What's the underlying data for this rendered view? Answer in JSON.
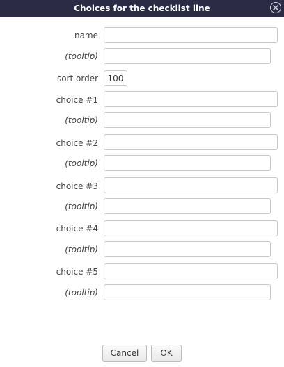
{
  "dialog": {
    "title": "Choices for the checklist line",
    "close_icon": "close-icon"
  },
  "form": {
    "name_label": "name",
    "tooltip_label": "(tooltip)",
    "sort_label": "sort order",
    "sort_value": "100",
    "choices": [
      {
        "label": "choice #1",
        "tooltip_label": "(tooltip)"
      },
      {
        "label": "choice #2",
        "tooltip_label": "(tooltip)"
      },
      {
        "label": "choice #3",
        "tooltip_label": "(tooltip)"
      },
      {
        "label": "choice #4",
        "tooltip_label": "(tooltip)"
      },
      {
        "label": "choice #5",
        "tooltip_label": "(tooltip)"
      }
    ]
  },
  "buttons": {
    "cancel_label": "Cancel",
    "ok_label": "OK"
  }
}
